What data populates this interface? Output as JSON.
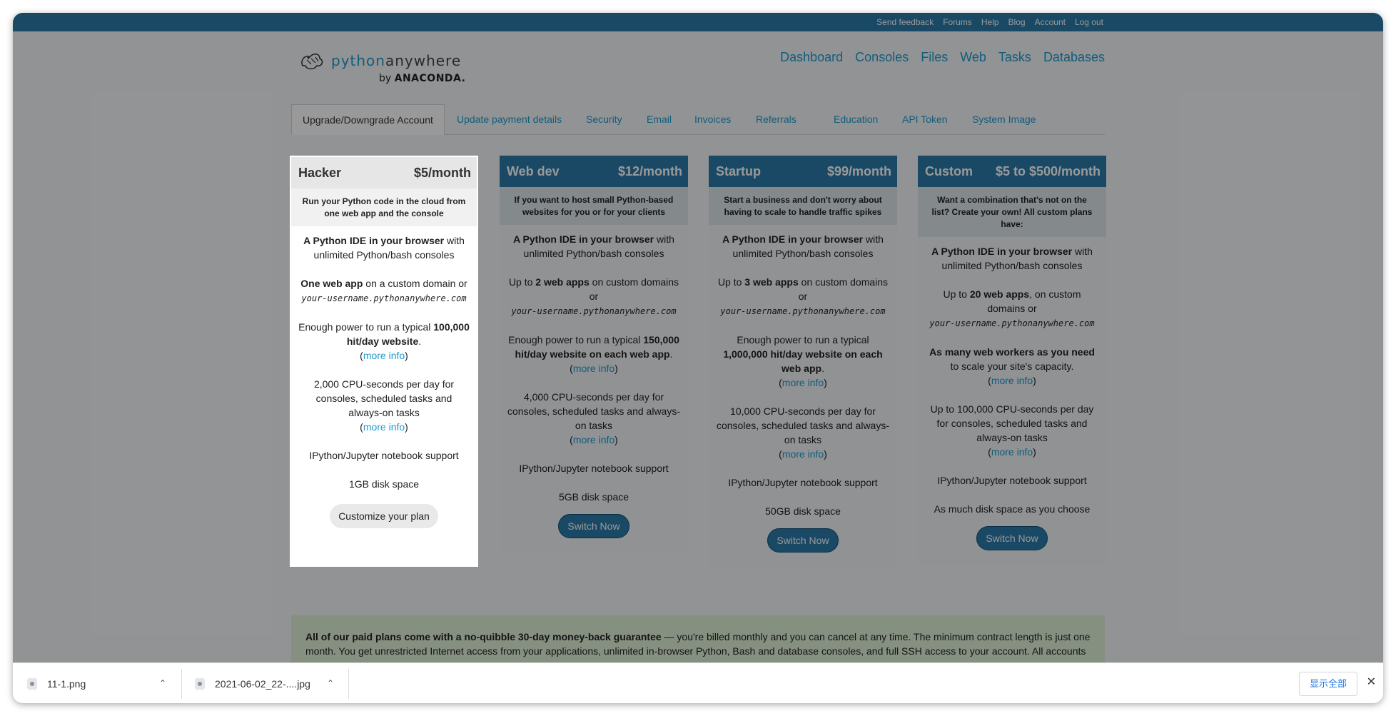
{
  "topbar": {
    "links": [
      "Send feedback",
      "Forums",
      "Help",
      "Blog",
      "Account",
      "Log out"
    ]
  },
  "logo": {
    "python": "python",
    "anywhere": "anywhere",
    "by": "by",
    "anaconda": "ANACONDA."
  },
  "nav": {
    "items": [
      "Dashboard",
      "Consoles",
      "Files",
      "Web",
      "Tasks",
      "Databases"
    ]
  },
  "tabs": [
    {
      "label": "Upgrade/Downgrade Account",
      "active": true
    },
    {
      "label": "Update payment details"
    },
    {
      "label": "Security"
    },
    {
      "label": "Email"
    },
    {
      "label": "Invoices"
    },
    {
      "label": "Referrals"
    },
    {
      "label": "Education"
    },
    {
      "label": "API Token"
    },
    {
      "label": "System Image"
    }
  ],
  "plans": {
    "hacker": {
      "name": "Hacker",
      "price": "$5/month",
      "tagline": "Run your Python code in the cloud from one web app and the console",
      "ide_bold": "A Python IDE in your browser",
      "ide_rest": " with unlimited Python/bash consoles",
      "apps_bold": "One web app",
      "apps_rest": " on a custom domain or",
      "domain": "your-username.pythonanywhere.com",
      "power_pre": "Enough power to run a typical ",
      "power_bold": "100,000 hit/day website",
      "power_post": ".",
      "more_info": "more info",
      "cpu": "2,000 CPU-seconds per day for consoles, scheduled tasks and always-on tasks",
      "jupyter": "IPython/Jupyter notebook support",
      "disk": "1GB disk space",
      "button": "Customize your plan"
    },
    "webdev": {
      "name": "Web dev",
      "price": "$12/month",
      "tagline": "If you want to host small Python-based websites for you or for your clients",
      "ide_bold": "A Python IDE in your browser",
      "ide_rest": " with unlimited Python/bash consoles",
      "apps_pre": "Up to ",
      "apps_bold": "2 web apps",
      "apps_rest": " on custom domains or",
      "domain": "your-username.pythonanywhere.com",
      "power_pre": "Enough power to run a typical ",
      "power_bold": "150,000 hit/day website on each web app",
      "power_post": ".",
      "more_info": "more info",
      "cpu": "4,000 CPU-seconds per day for consoles, scheduled tasks and always-on tasks",
      "jupyter": "IPython/Jupyter notebook support",
      "disk": "5GB disk space",
      "button": "Switch Now"
    },
    "startup": {
      "name": "Startup",
      "price": "$99/month",
      "tagline": "Start a business and don't worry about having to scale to handle traffic spikes",
      "ide_bold": "A Python IDE in your browser",
      "ide_rest": " with unlimited Python/bash consoles",
      "apps_pre": "Up to ",
      "apps_bold": "3 web apps",
      "apps_rest": " on custom domains or",
      "domain": "your-username.pythonanywhere.com",
      "power_pre": "Enough power to run a typical ",
      "power_bold": "1,000,000 hit/day website on each web app",
      "power_post": ".",
      "more_info": "more info",
      "cpu": "10,000 CPU-seconds per day for consoles, scheduled tasks and always-on tasks",
      "jupyter": "IPython/Jupyter notebook support",
      "disk": "50GB disk space",
      "button": "Switch Now"
    },
    "custom": {
      "name": "Custom",
      "price": "$5 to $500/month",
      "tagline": "Want a combination that's not on the list? Create your own! All custom plans have:",
      "ide_bold": "A Python IDE in your browser",
      "ide_rest": " with unlimited Python/bash consoles",
      "apps_pre": "Up to ",
      "apps_bold": "20 web apps",
      "apps_rest": ", on custom domains or",
      "domain": "your-username.pythonanywhere.com",
      "power_bold": "As many web workers as you need",
      "power_post": " to scale your site's capacity.",
      "more_info": "more info",
      "cpu": "Up to 100,000 CPU-seconds per day for consoles, scheduled tasks and always-on tasks",
      "jupyter": "IPython/Jupyter notebook support",
      "disk": "As much disk space as you choose",
      "button": "Switch Now"
    }
  },
  "notice": {
    "bold": "All of our paid plans come with a no-quibble 30-day money-back guarantee",
    "rest": " — you're billed monthly and you can cancel at any time. The minimum contract length is just one month. You get unrestricted Internet access from your applications, unlimited in-browser Python, Bash and database consoles, and full SSH access to your account. All accounts"
  },
  "downloads": {
    "items": [
      {
        "name": "11-1.png"
      },
      {
        "name": "2021-06-02_22-....jpg"
      }
    ],
    "show_all": "显示全部",
    "close": "✕"
  }
}
